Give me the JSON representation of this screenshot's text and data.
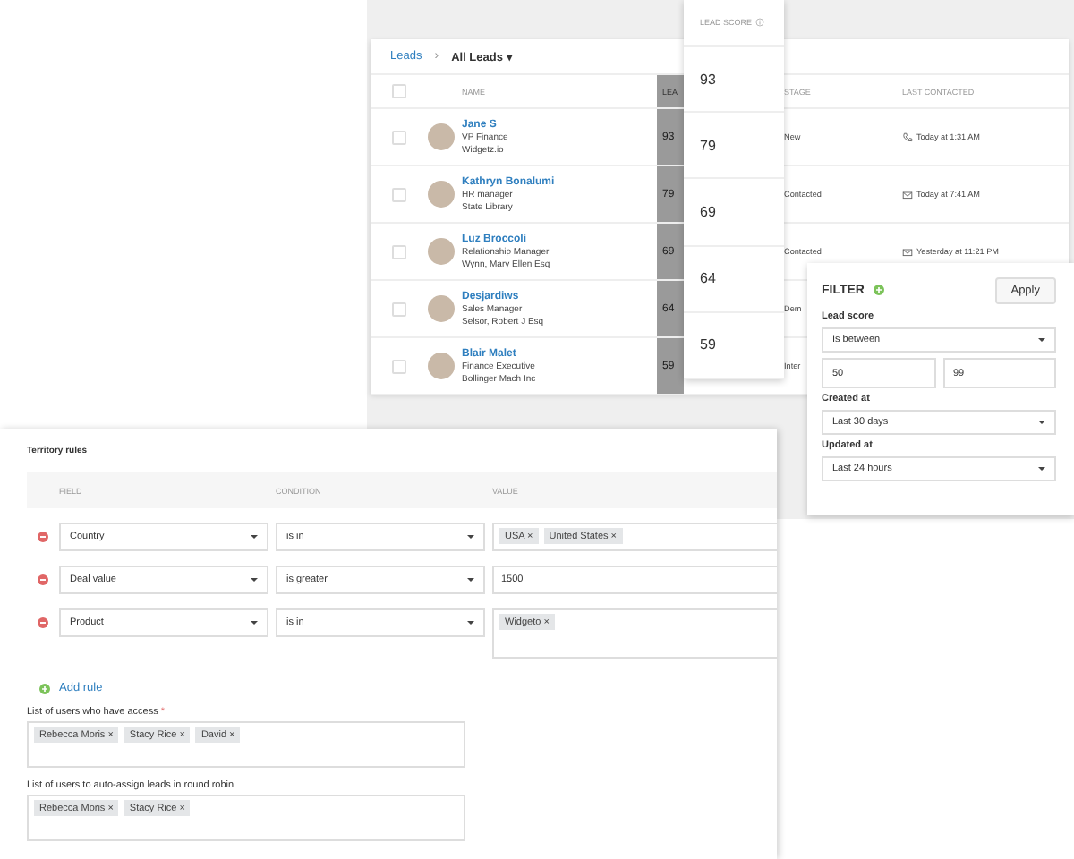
{
  "breadcrumb": {
    "root": "Leads",
    "separator": "›",
    "current": "All Leads",
    "caret": "▾"
  },
  "table": {
    "select_all_checked": false,
    "columns": [
      "NAME",
      "LEA",
      "STAGE",
      "LAST CONTACTED"
    ],
    "rows": [
      {
        "checked": false,
        "name": "Jane S",
        "title": "VP Finance",
        "company": "Widgetz.io",
        "score": "93",
        "stage": "New",
        "last_contacted": "Today at 1:31 AM",
        "kind": "call"
      },
      {
        "checked": false,
        "name": "Kathryn Bonalumi",
        "title": "HR manager",
        "company": "State Library",
        "score": "79",
        "stage": "Contacted",
        "last_contacted": "Today at 7:41 AM",
        "kind": "email"
      },
      {
        "checked": false,
        "name": "Luz Broccoli",
        "title": "Relationship Manager",
        "company": "Wynn, Mary Ellen Esq",
        "score": "69",
        "stage": "Contacted",
        "last_contacted": "Yesterday at 11:21 PM",
        "kind": "email"
      },
      {
        "checked": false,
        "name": "Desjardiws",
        "title": "Sales Manager",
        "company": "Selsor, Robert J Esq",
        "score": "64",
        "stage": "Dem"
      },
      {
        "checked": false,
        "name": "Blair Malet",
        "title": "Finance Executive",
        "company": "Bollinger Mach Inc",
        "score": "59",
        "stage": "Inter"
      }
    ]
  },
  "score_popout": {
    "title": "LEAD SCORE",
    "scores": [
      "93",
      "79",
      "69",
      "64",
      "59"
    ]
  },
  "filter": {
    "title": "FILTER",
    "apply": "Apply",
    "lead_score_label": "Lead score",
    "lead_score_condition": "Is between",
    "min": "50",
    "max": "99",
    "created_label": "Created at",
    "created_value": "Last 30 days",
    "updated_label": "Updated at",
    "updated_value": "Last 24 hours"
  },
  "territory": {
    "title": "Territory rules",
    "columns": [
      "FIELD",
      "CONDITION",
      "VALUE"
    ],
    "rules": [
      {
        "field": "Country",
        "condition": "is in",
        "kind": "tags",
        "tags": [
          "USA",
          "United States"
        ]
      },
      {
        "field": "Deal value",
        "condition": "is greater",
        "kind": "text",
        "value": "1500"
      },
      {
        "field": "Product",
        "condition": "is in",
        "kind": "tags",
        "tags": [
          "Widgeto"
        ]
      }
    ],
    "add_rule": "Add rule",
    "access_label": "List of users who have access",
    "access_required": "*",
    "access_users": [
      "Rebecca Moris",
      "Stacy Rice",
      "David"
    ],
    "robin_label": "List of users to auto-assign leads in round robin",
    "robin_users": [
      "Rebecca Moris",
      "Stacy Rice"
    ],
    "tag_remove": "×"
  }
}
